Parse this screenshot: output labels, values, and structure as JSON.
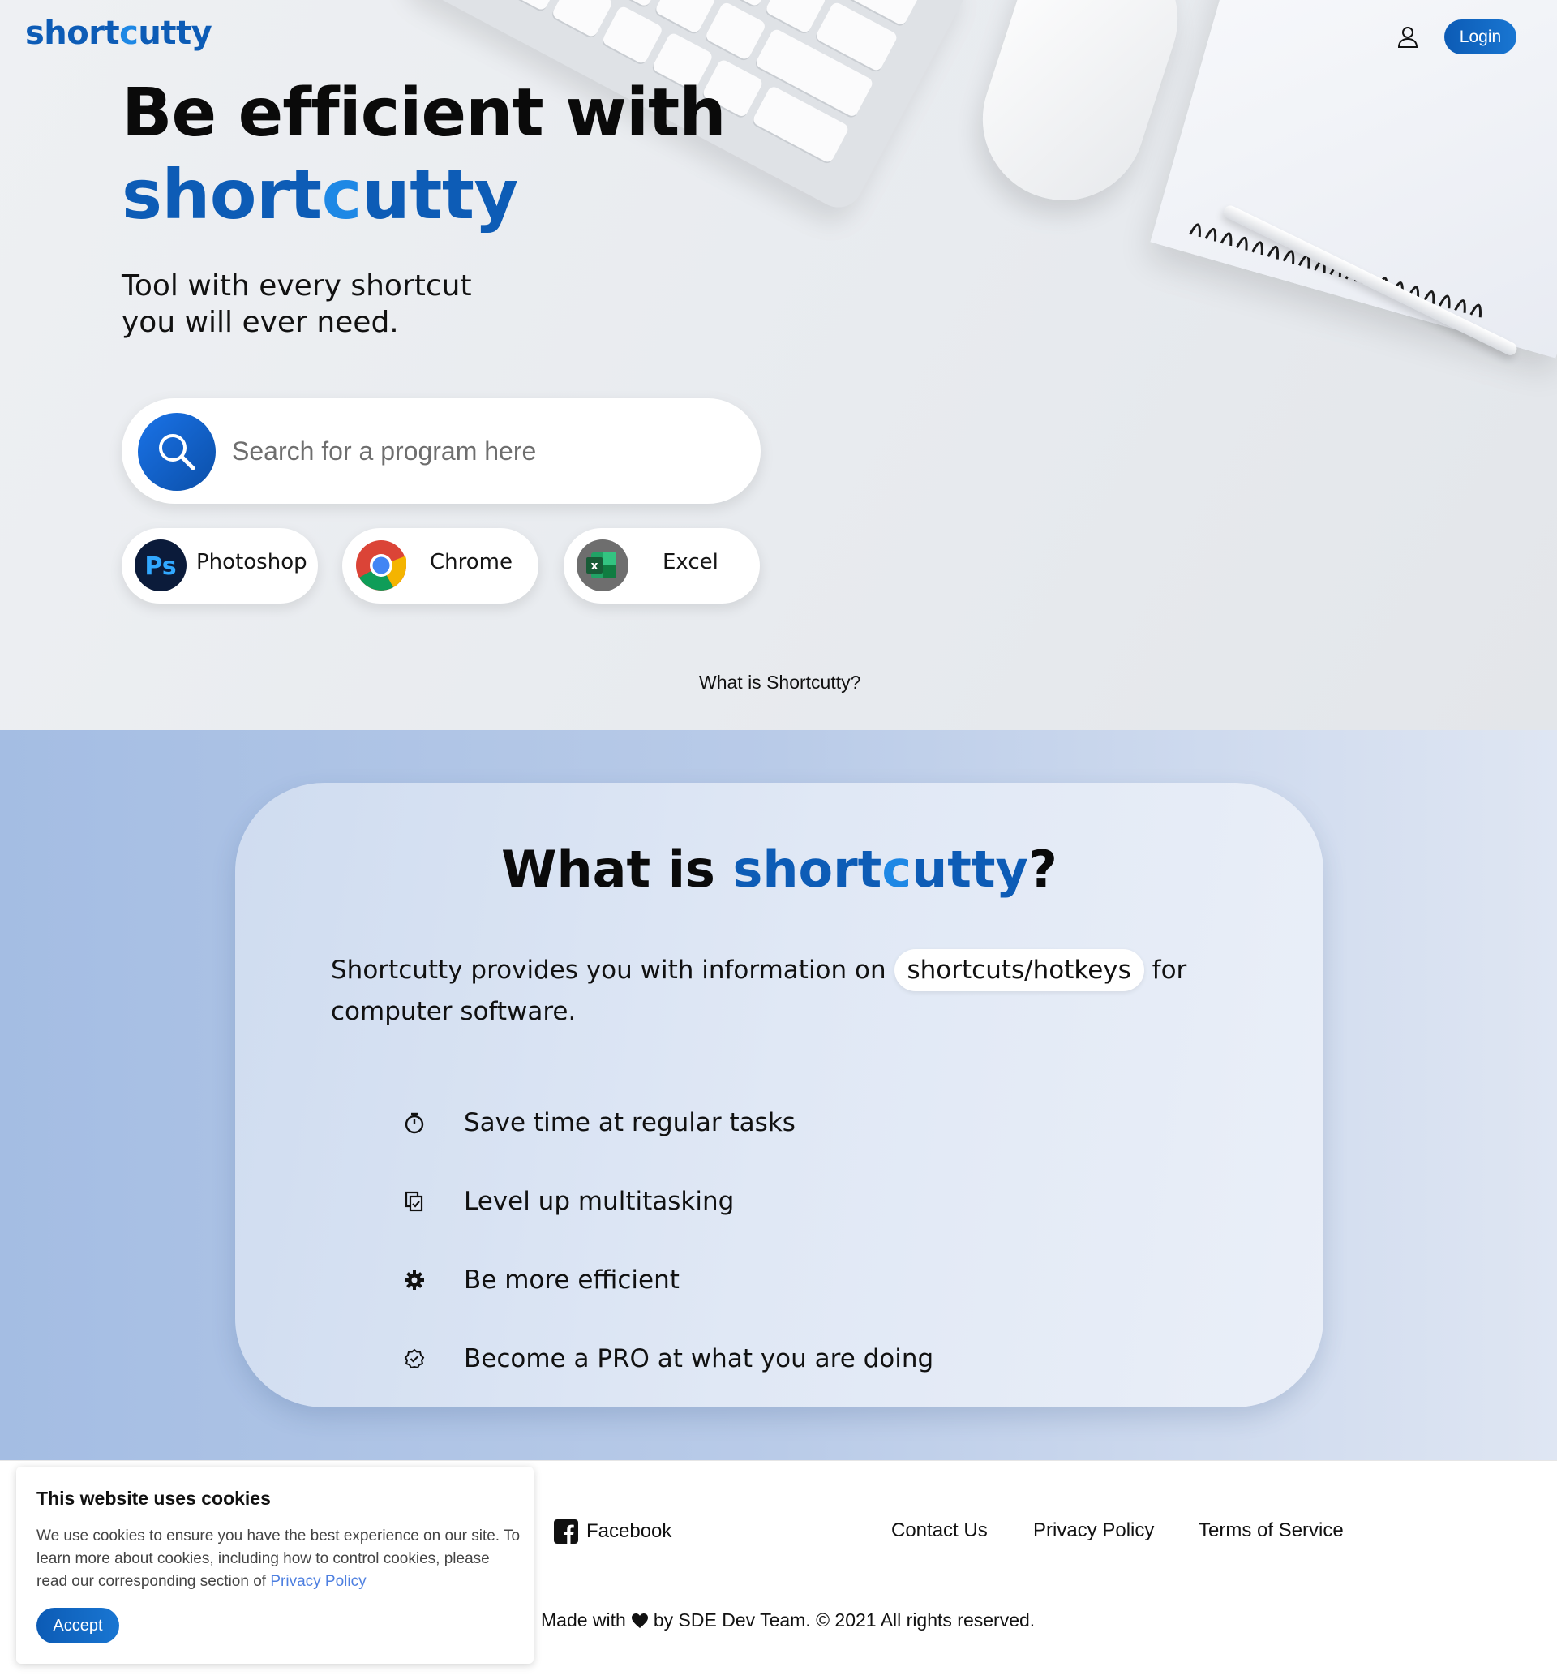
{
  "header": {
    "logo_a": "short",
    "logo_c": "c",
    "logo_b": "utty",
    "login_label": "Login"
  },
  "hero": {
    "title": "Be efficient with",
    "brand_a": "short",
    "brand_c": "c",
    "brand_b": "utty",
    "subtitle_line1": "Tool with every shortcut",
    "subtitle_line2": "you will ever need.",
    "search_placeholder": "Search for a program here",
    "quick_programs": [
      {
        "label": "Photoshop",
        "icon": "photoshop-icon"
      },
      {
        "label": "Chrome",
        "icon": "chrome-icon"
      },
      {
        "label": "Excel",
        "icon": "excel-icon"
      }
    ],
    "what_link": "What is Shortcutty?"
  },
  "about": {
    "title_prefix": "What is",
    "brand_a": "short",
    "brand_c": "c",
    "brand_b": "utty",
    "title_suffix": "?",
    "desc_before": "Shortcutty provides you with information on",
    "desc_pill": "shortcuts/hotkeys",
    "desc_after": "for computer software.",
    "features": [
      {
        "text": "Save time at regular tasks",
        "icon": "stopwatch-icon"
      },
      {
        "text": "Level up multitasking",
        "icon": "copy-check-icon"
      },
      {
        "text": "Be more efficient",
        "icon": "gear-icon"
      },
      {
        "text": "Become a PRO at what you are doing",
        "icon": "badge-check-icon"
      }
    ]
  },
  "footer": {
    "facebook": "Facebook",
    "contact": "Contact Us",
    "privacy": "Privacy Policy",
    "terms": "Terms of Service",
    "made_prefix": "Made with",
    "made_suffix": "by SDE Dev Team. © 2021 All rights reserved."
  },
  "cookie": {
    "title": "This website uses cookies",
    "text": "We use cookies to ensure you have the best experience on our site. To learn more about cookies, including how to control cookies, please read our corresponding section of",
    "link": "Privacy Policy",
    "accept": "Accept"
  },
  "colors": {
    "brand_dark": "#0d5cb6",
    "brand_light": "#1e88e5"
  }
}
